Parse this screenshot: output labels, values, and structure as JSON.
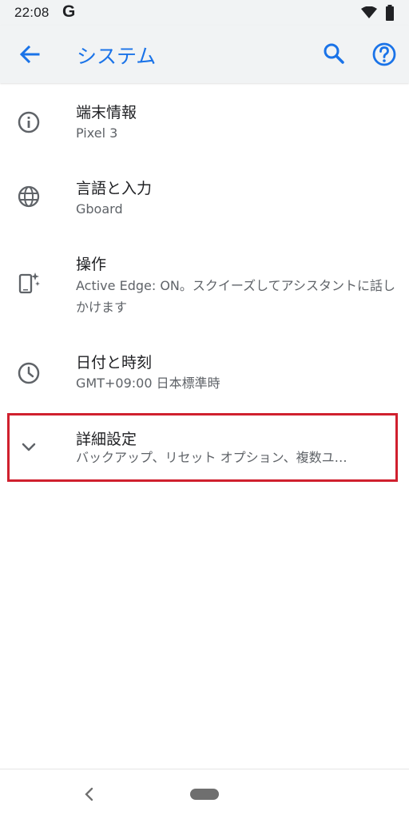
{
  "status_bar": {
    "time": "22:08",
    "google_badge": "G"
  },
  "app_bar": {
    "title": "システム"
  },
  "items": [
    {
      "icon": "info-icon",
      "title": "端末情報",
      "subtitle": "Pixel 3"
    },
    {
      "icon": "globe-icon",
      "title": "言語と入力",
      "subtitle": "Gboard"
    },
    {
      "icon": "phone-gesture-icon",
      "title": "操作",
      "subtitle": "Active Edge: ON。スクイーズしてアシスタントに話しかけます"
    },
    {
      "icon": "clock-icon",
      "title": "日付と時刻",
      "subtitle": "GMT+09:00 日本標準時"
    },
    {
      "icon": "chevron-down-icon",
      "title": "詳細設定",
      "subtitle": "バックアップ、リセット オプション、複数ユ…"
    }
  ],
  "colors": {
    "accent": "#1a73e8",
    "highlight": "#d0202e",
    "app_bar_bg": "#f1f3f4"
  }
}
